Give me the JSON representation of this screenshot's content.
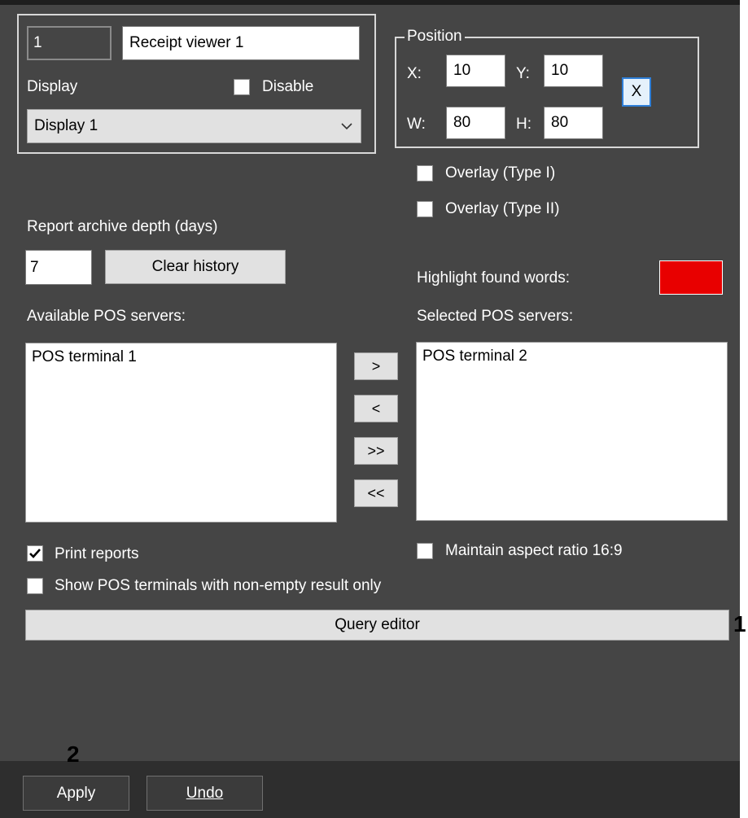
{
  "header": {
    "camera_id": "1",
    "name": "Receipt viewer 1",
    "display_label": "Display",
    "disable_label": "Disable",
    "display_selected": "Display 1"
  },
  "position": {
    "legend": "Position",
    "x_label": "X:",
    "x_value": "10",
    "y_label": "Y:",
    "y_value": "10",
    "w_label": "W:",
    "w_value": "80",
    "h_label": "H:",
    "h_value": "80",
    "pick_button": "X"
  },
  "overlay": {
    "type1_label": "Overlay (Type I)",
    "type2_label": "Overlay (Type II)"
  },
  "archive": {
    "depth_label": "Report archive depth (days)",
    "depth_value": "7",
    "clear_history_label": "Clear history"
  },
  "highlight": {
    "label": "Highlight found words:",
    "color": "#e80000"
  },
  "servers": {
    "available_label": "Available POS servers:",
    "available_items": [
      "POS terminal 1"
    ],
    "selected_label": "Selected POS servers:",
    "selected_items": [
      "POS terminal 2"
    ],
    "move_right": ">",
    "move_left": "<",
    "move_all_right": ">>",
    "move_all_left": "<<"
  },
  "options": {
    "print_reports_label": "Print reports",
    "print_reports_checked": true,
    "show_nonempty_label": "Show POS terminals with non-empty result only",
    "show_nonempty_checked": false,
    "aspect_label": "Maintain aspect ratio 16:9",
    "aspect_checked": false
  },
  "query_editor_label": "Query editor",
  "annotations": {
    "one": "1",
    "two": "2"
  },
  "footer": {
    "apply_label": "Apply",
    "undo_label": "Undo"
  }
}
